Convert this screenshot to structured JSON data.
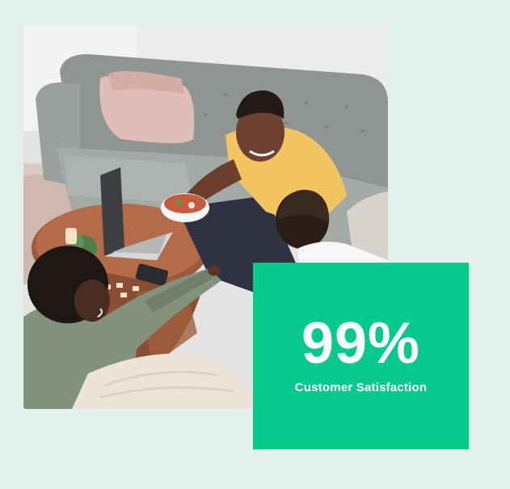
{
  "photo": {
    "subject": "family-living-room-photo"
  },
  "stat": {
    "value": "99%",
    "label": "Customer Satisfaction"
  },
  "colors": {
    "background": "#e3f1ec",
    "accent": "#06c98c",
    "text_on_accent": "#ffffff"
  }
}
